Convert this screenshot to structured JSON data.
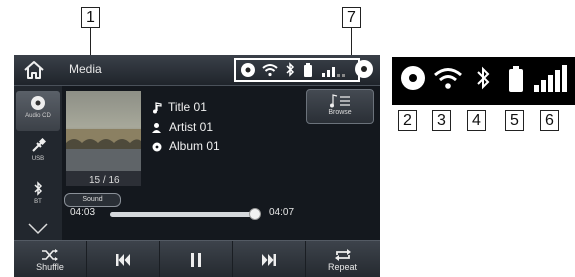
{
  "callouts": [
    "1",
    "7",
    "2",
    "3",
    "4",
    "5",
    "6"
  ],
  "header": {
    "title": "Media"
  },
  "sources": [
    {
      "label": "Audio CD",
      "icon": "disc-icon"
    },
    {
      "label": "USB",
      "icon": "usb-icon"
    },
    {
      "label": "BT",
      "icon": "bluetooth-icon"
    }
  ],
  "now_playing": {
    "title": "Title 01",
    "artist": "Artist 01",
    "album": "Album 01",
    "track_position": "15 / 16",
    "elapsed": "04:03",
    "total": "04:07",
    "progress": 0.98
  },
  "buttons": {
    "sound": "Sound",
    "browse": "Browse",
    "shuffle": "Shuffle",
    "repeat": "Repeat"
  },
  "colors": {
    "screen_bg": "#14181e",
    "text": "#e8e8e8",
    "highlight_box": "#ffffff"
  }
}
